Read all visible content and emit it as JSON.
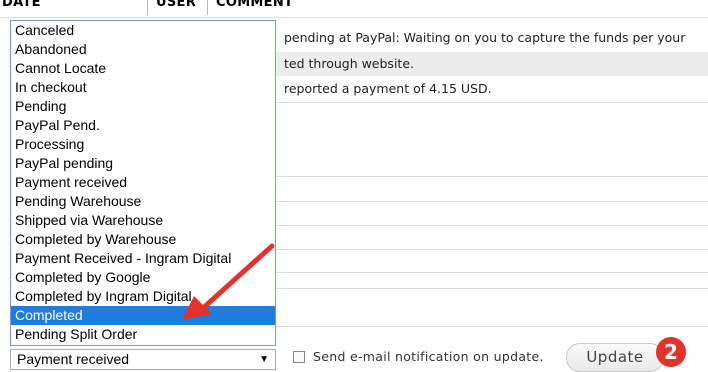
{
  "table_header": {
    "date": "DATE",
    "user": "USER",
    "comment": "COMMENT"
  },
  "comment_rows": [
    "pending at PayPal: Waiting on you to capture the funds per your",
    "ted through website.",
    "reported a payment of 4.15 USD."
  ],
  "status_options": [
    "Canceled",
    "Abandoned",
    "Cannot Locate",
    "In checkout",
    "Pending",
    "PayPal Pend.",
    "Processing",
    "PayPal pending",
    "Payment received",
    "Pending Warehouse",
    "Shipped via Warehouse",
    "Completed by Warehouse",
    "Payment Received - Ingram Digital",
    "Completed by Google",
    "Completed by Ingram Digital",
    "Completed",
    "Pending Split Order"
  ],
  "highlighted_option": "Completed",
  "status_select": {
    "value": "Payment received"
  },
  "notify": {
    "label": "Send e-mail notification on update.",
    "checked": false
  },
  "update_button": {
    "label": "Update"
  },
  "step_badge": {
    "number": "2"
  },
  "colors": {
    "highlight": "#1e7ce0",
    "annotation": "#e2322b"
  }
}
